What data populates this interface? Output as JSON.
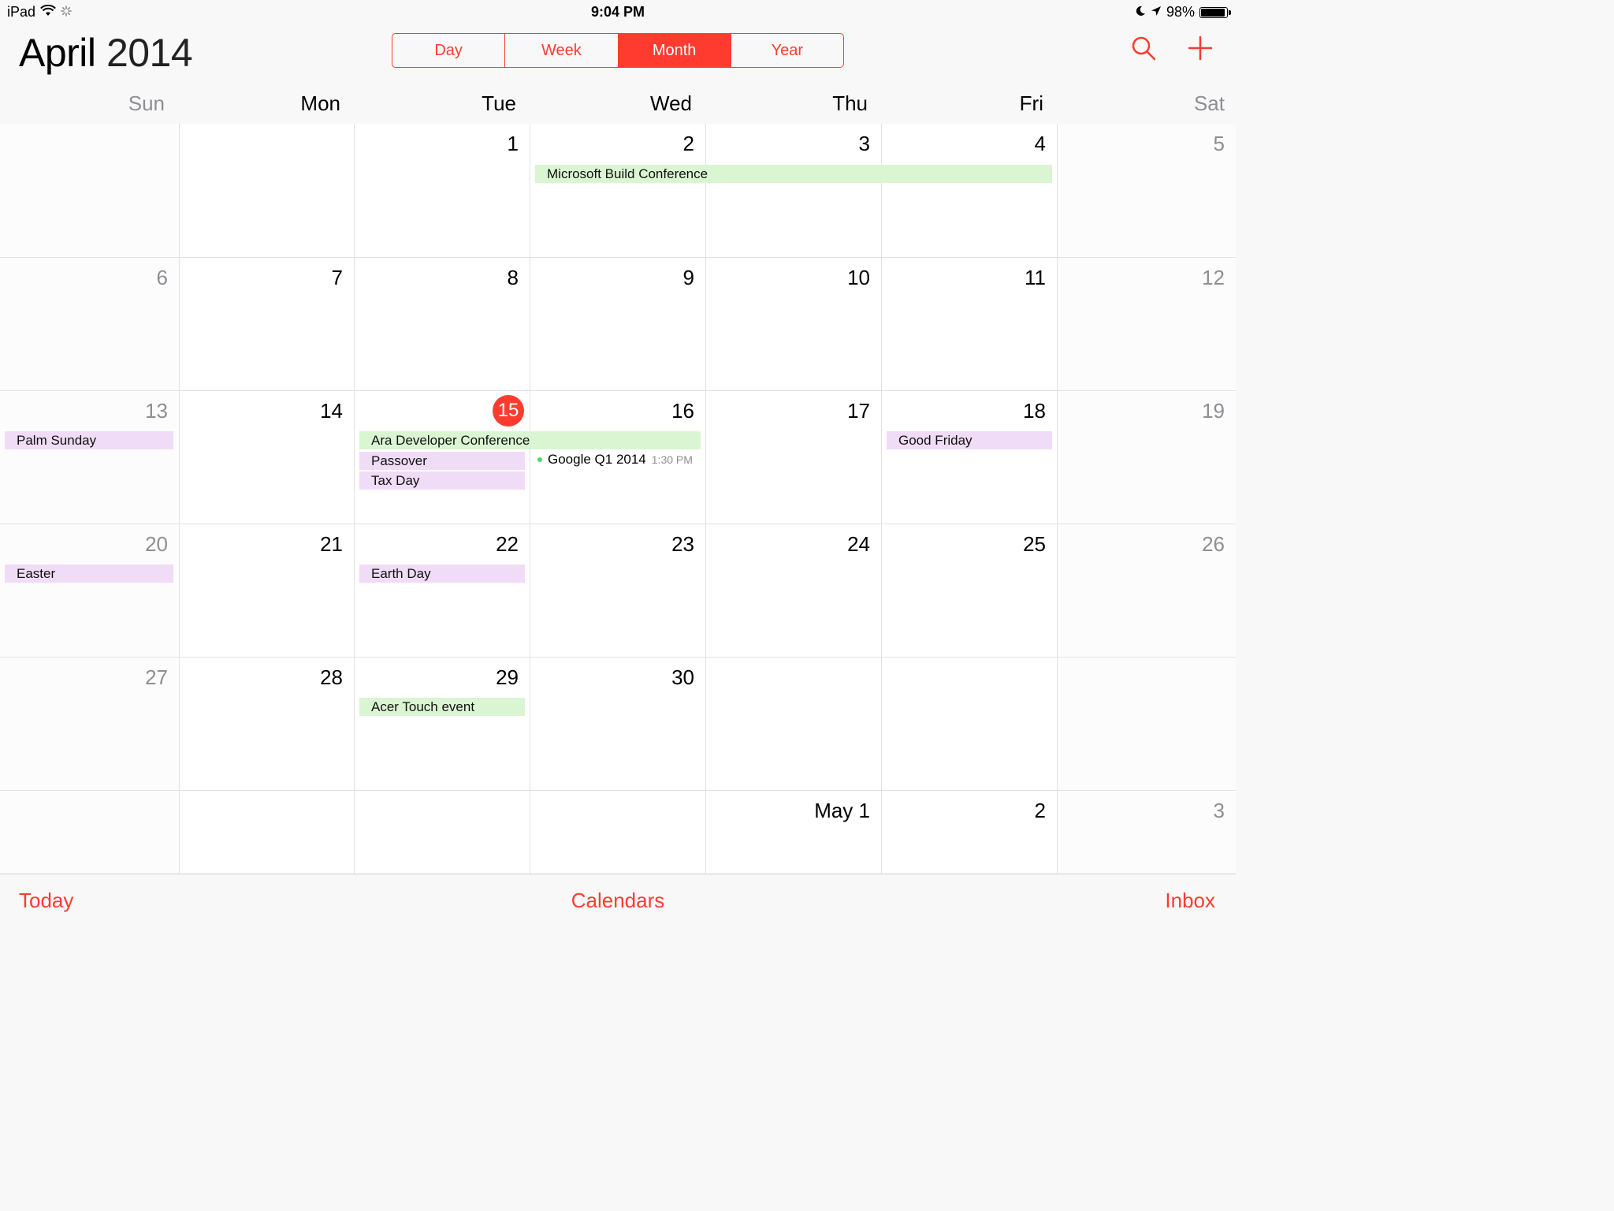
{
  "status_bar": {
    "device": "iPad",
    "time": "9:04 PM",
    "battery": "98%",
    "battery_level": 0.98
  },
  "header": {
    "month": "April",
    "year": "2014",
    "views": [
      "Day",
      "Week",
      "Month",
      "Year"
    ],
    "active_view": "Month",
    "search_icon": "search-icon",
    "add_icon": "plus-icon"
  },
  "weekdays": [
    "Sun",
    "Mon",
    "Tue",
    "Wed",
    "Thu",
    "Fri",
    "Sat"
  ],
  "weeks": [
    [
      "",
      "",
      "1",
      "2",
      "3",
      "4",
      "5"
    ],
    [
      "6",
      "7",
      "8",
      "9",
      "10",
      "11",
      "12"
    ],
    [
      "13",
      "14",
      "15",
      "16",
      "17",
      "18",
      "19"
    ],
    [
      "20",
      "21",
      "22",
      "23",
      "24",
      "25",
      "26"
    ],
    [
      "27",
      "28",
      "29",
      "30",
      "",
      "",
      ""
    ],
    [
      "",
      "",
      "",
      "",
      "May 1",
      "2",
      "3"
    ]
  ],
  "today": "15",
  "events": {
    "microsoft_build": "Microsoft Build Conference",
    "palm_sunday": "Palm Sunday",
    "ara_developer": "Ara Developer Conference",
    "passover": "Passover",
    "tax_day": "Tax Day",
    "google_q1": "Google Q1 2014",
    "google_q1_time": "1:30 PM",
    "good_friday": "Good Friday",
    "easter": "Easter",
    "earth_day": "Earth Day",
    "acer_touch": "Acer Touch event"
  },
  "toolbar": {
    "today": "Today",
    "calendars": "Calendars",
    "inbox": "Inbox"
  },
  "colors": {
    "accent": "#ff3b30",
    "event_green": "#daf5d2",
    "event_purple": "#f0dcf6",
    "timed_dot": "#4cd964"
  }
}
